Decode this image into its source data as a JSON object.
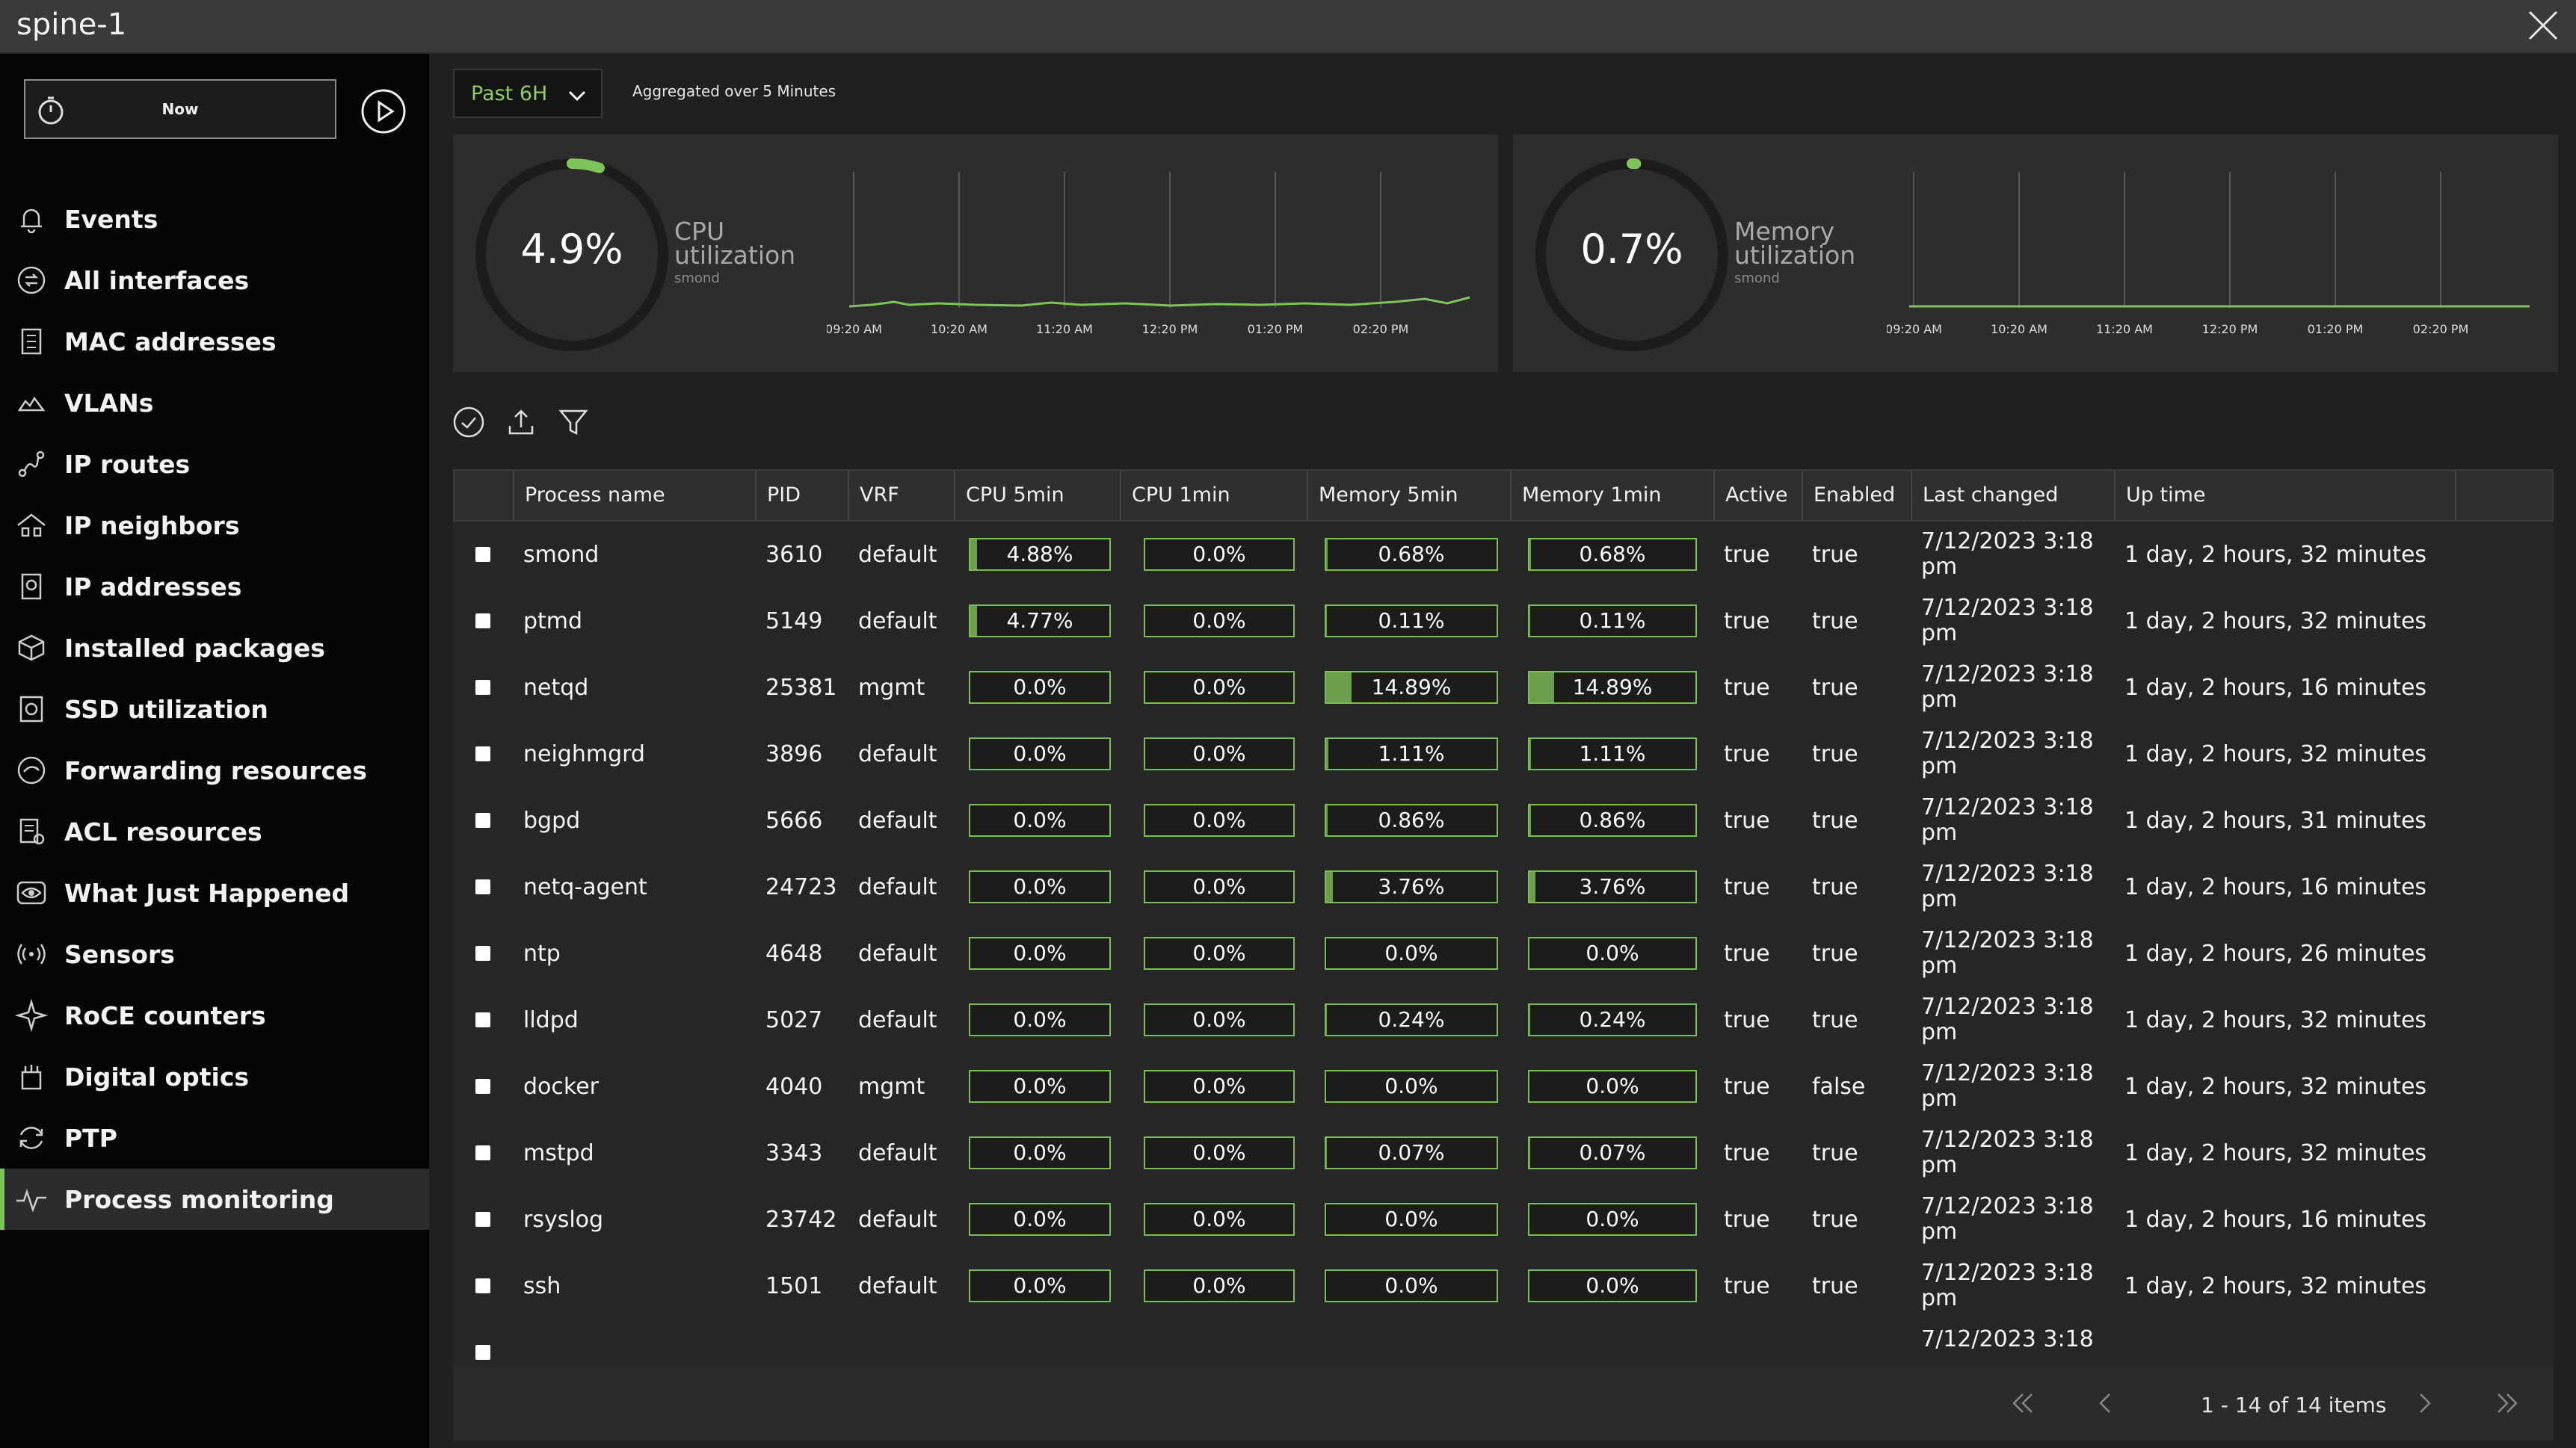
{
  "window": {
    "title": "spine-1"
  },
  "sidebar": {
    "now_label": "Now",
    "items": [
      {
        "label": "Events",
        "icon": "bell-icon"
      },
      {
        "label": "All interfaces",
        "icon": "interfaces-icon"
      },
      {
        "label": "MAC addresses",
        "icon": "mac-address-icon"
      },
      {
        "label": "VLANs",
        "icon": "vlan-icon"
      },
      {
        "label": "IP routes",
        "icon": "route-icon"
      },
      {
        "label": "IP neighbors",
        "icon": "neighbors-icon"
      },
      {
        "label": "IP addresses",
        "icon": "ip-address-icon"
      },
      {
        "label": "Installed packages",
        "icon": "package-icon"
      },
      {
        "label": "SSD utilization",
        "icon": "ssd-icon"
      },
      {
        "label": "Forwarding resources",
        "icon": "forwarding-icon"
      },
      {
        "label": "ACL resources",
        "icon": "acl-icon"
      },
      {
        "label": "What Just Happened",
        "icon": "eye-icon"
      },
      {
        "label": "Sensors",
        "icon": "sensor-icon"
      },
      {
        "label": "RoCE counters",
        "icon": "roce-icon"
      },
      {
        "label": "Digital optics",
        "icon": "optics-icon"
      },
      {
        "label": "PTP",
        "icon": "sync-icon"
      },
      {
        "label": "Process monitoring",
        "icon": "pulse-icon",
        "active": true
      }
    ]
  },
  "controls": {
    "range": "Past 6H",
    "aggregation": "Aggregated over 5 Minutes"
  },
  "cards": {
    "cpu": {
      "percent": "4.9%",
      "title_line1": "CPU",
      "title_line2": "utilization",
      "subtitle": "smond",
      "value": 0.049
    },
    "memory": {
      "percent": "0.7%",
      "title_line1": "Memory",
      "title_line2": "utilization",
      "subtitle": "smond",
      "value": 0.007
    },
    "time_labels": [
      "09:20 AM",
      "10:20 AM",
      "11:20 AM",
      "12:20 PM",
      "01:20 PM",
      "02:20 PM"
    ]
  },
  "table": {
    "columns": [
      "Process name",
      "PID",
      "VRF",
      "CPU 5min",
      "CPU 1min",
      "Memory 5min",
      "Memory 1min",
      "Active",
      "Enabled",
      "Last changed",
      "Up time"
    ],
    "rows": [
      {
        "name": "smond",
        "pid": "3610",
        "vrf": "default",
        "cpu5": "4.88%",
        "cpu1": "0.0%",
        "mem5": "0.68%",
        "mem1": "0.68%",
        "active": "true",
        "enabled": "true",
        "changed1": "7/12/2023 3:18",
        "changed2": "pm",
        "uptime": "1 day, 2 hours, 32 minutes"
      },
      {
        "name": "ptmd",
        "pid": "5149",
        "vrf": "default",
        "cpu5": "4.77%",
        "cpu1": "0.0%",
        "mem5": "0.11%",
        "mem1": "0.11%",
        "active": "true",
        "enabled": "true",
        "changed1": "7/12/2023 3:18",
        "changed2": "pm",
        "uptime": "1 day, 2 hours, 32 minutes"
      },
      {
        "name": "netqd",
        "pid": "25381",
        "vrf": "mgmt",
        "cpu5": "0.0%",
        "cpu1": "0.0%",
        "mem5": "14.89%",
        "mem1": "14.89%",
        "active": "true",
        "enabled": "true",
        "changed1": "7/12/2023 3:18",
        "changed2": "pm",
        "uptime": "1 day, 2 hours, 16 minutes"
      },
      {
        "name": "neighmgrd",
        "pid": "3896",
        "vrf": "default",
        "cpu5": "0.0%",
        "cpu1": "0.0%",
        "mem5": "1.11%",
        "mem1": "1.11%",
        "active": "true",
        "enabled": "true",
        "changed1": "7/12/2023 3:18",
        "changed2": "pm",
        "uptime": "1 day, 2 hours, 32 minutes"
      },
      {
        "name": "bgpd",
        "pid": "5666",
        "vrf": "default",
        "cpu5": "0.0%",
        "cpu1": "0.0%",
        "mem5": "0.86%",
        "mem1": "0.86%",
        "active": "true",
        "enabled": "true",
        "changed1": "7/12/2023 3:18",
        "changed2": "pm",
        "uptime": "1 day, 2 hours, 31 minutes"
      },
      {
        "name": "netq-agent",
        "pid": "24723",
        "vrf": "default",
        "cpu5": "0.0%",
        "cpu1": "0.0%",
        "mem5": "3.76%",
        "mem1": "3.76%",
        "active": "true",
        "enabled": "true",
        "changed1": "7/12/2023 3:18",
        "changed2": "pm",
        "uptime": "1 day, 2 hours, 16 minutes"
      },
      {
        "name": "ntp",
        "pid": "4648",
        "vrf": "default",
        "cpu5": "0.0%",
        "cpu1": "0.0%",
        "mem5": "0.0%",
        "mem1": "0.0%",
        "active": "true",
        "enabled": "true",
        "changed1": "7/12/2023 3:18",
        "changed2": "pm",
        "uptime": "1 day, 2 hours, 26 minutes"
      },
      {
        "name": "lldpd",
        "pid": "5027",
        "vrf": "default",
        "cpu5": "0.0%",
        "cpu1": "0.0%",
        "mem5": "0.24%",
        "mem1": "0.24%",
        "active": "true",
        "enabled": "true",
        "changed1": "7/12/2023 3:18",
        "changed2": "pm",
        "uptime": "1 day, 2 hours, 32 minutes"
      },
      {
        "name": "docker",
        "pid": "4040",
        "vrf": "mgmt",
        "cpu5": "0.0%",
        "cpu1": "0.0%",
        "mem5": "0.0%",
        "mem1": "0.0%",
        "active": "true",
        "enabled": "false",
        "changed1": "7/12/2023 3:18",
        "changed2": "pm",
        "uptime": "1 day, 2 hours, 32 minutes"
      },
      {
        "name": "mstpd",
        "pid": "3343",
        "vrf": "default",
        "cpu5": "0.0%",
        "cpu1": "0.0%",
        "mem5": "0.07%",
        "mem1": "0.07%",
        "active": "true",
        "enabled": "true",
        "changed1": "7/12/2023 3:18",
        "changed2": "pm",
        "uptime": "1 day, 2 hours, 32 minutes"
      },
      {
        "name": "rsyslog",
        "pid": "23742",
        "vrf": "default",
        "cpu5": "0.0%",
        "cpu1": "0.0%",
        "mem5": "0.0%",
        "mem1": "0.0%",
        "active": "true",
        "enabled": "true",
        "changed1": "7/12/2023 3:18",
        "changed2": "pm",
        "uptime": "1 day, 2 hours, 16 minutes"
      },
      {
        "name": "ssh",
        "pid": "1501",
        "vrf": "default",
        "cpu5": "0.0%",
        "cpu1": "0.0%",
        "mem5": "0.0%",
        "mem1": "0.0%",
        "active": "true",
        "enabled": "true",
        "changed1": "7/12/2023 3:18",
        "changed2": "pm",
        "uptime": "1 day, 2 hours, 32 minutes"
      },
      {
        "name": "",
        "pid": "",
        "vrf": "",
        "cpu5": "",
        "cpu1": "",
        "mem5": "",
        "mem1": "",
        "active": "",
        "enabled": "",
        "changed1": "7/12/2023 3:18",
        "changed2": "",
        "uptime": ""
      }
    ]
  },
  "pagination": {
    "info": "1 - 14 of 14 items"
  },
  "colors": {
    "accent": "#7fc45a",
    "panel": "#2d2d2d",
    "background": "#202020"
  }
}
